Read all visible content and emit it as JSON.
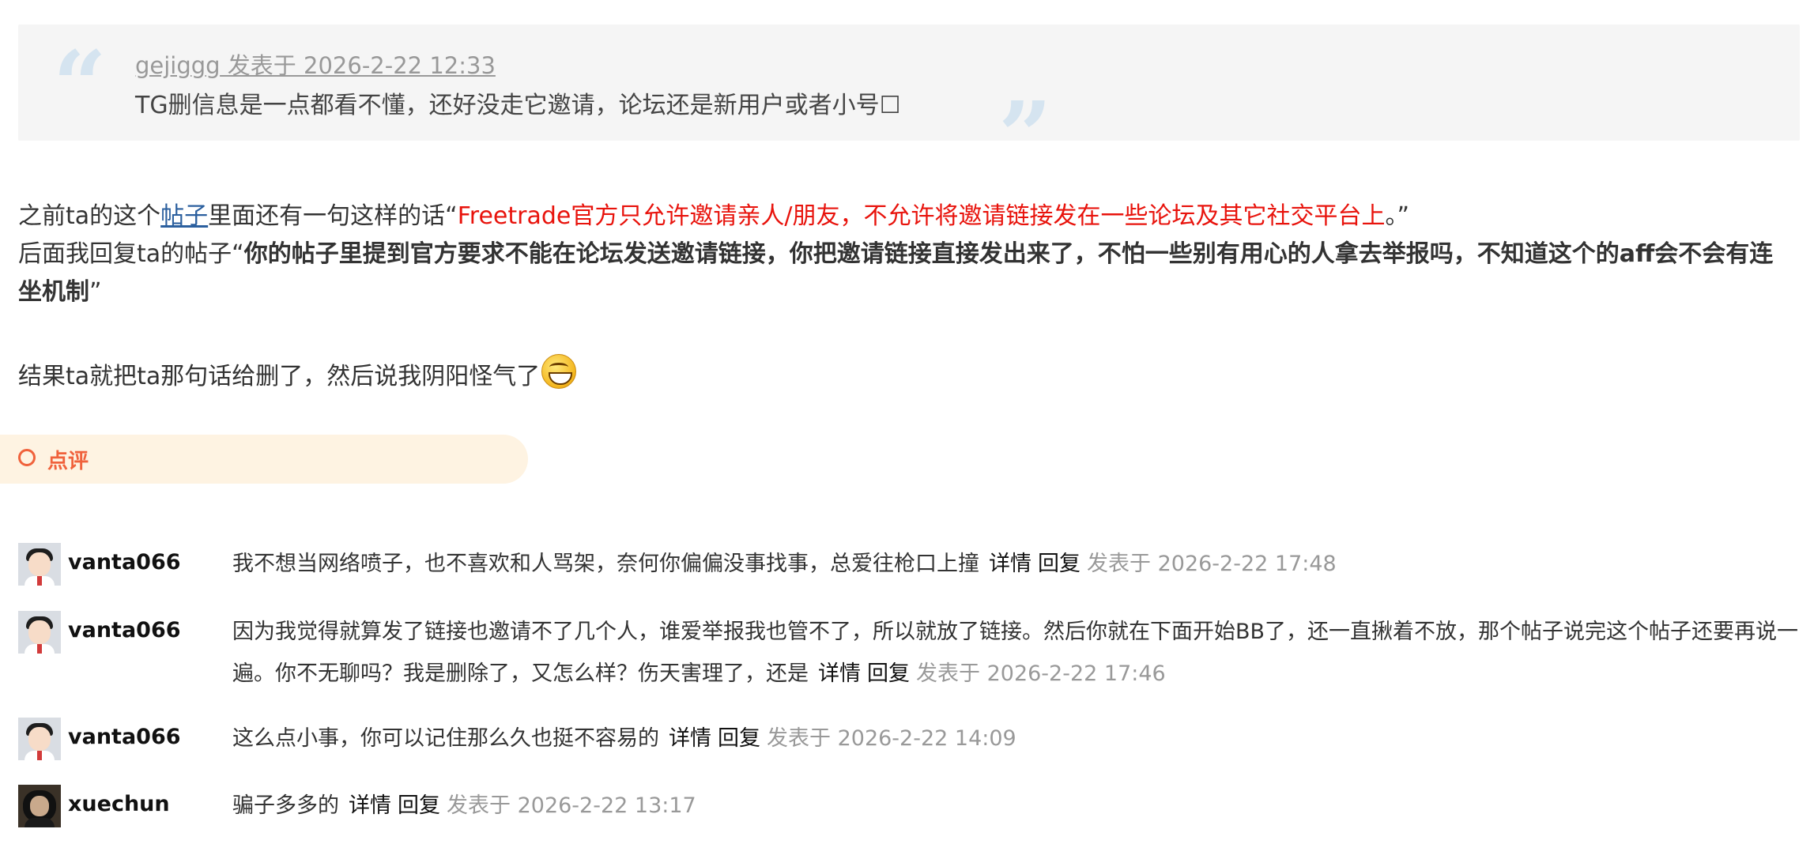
{
  "quote": {
    "author": "gejiggg",
    "meta_suffix": " 发表于 2026-2-22 12:33",
    "text": "TG删信息是一点都看不懂，还好没走它邀请，论坛还是新用户或者小号☐"
  },
  "post": {
    "line1_prefix": "之前ta的这个",
    "line1_link": "帖子",
    "line1_mid": "里面还有一句这样的话“",
    "line1_red": "Freetrade官方只允许邀请亲人/朋友，不允许将邀请链接发在一些论坛及其它社交平台上",
    "line1_suffix": "。”",
    "line2_prefix": "后面我回复ta的帖子“",
    "line2_bold": "你的帖子里提到官方要求不能在论坛发送邀请链接，你把邀请链接直接发出来了，不怕一些别有用心的人拿去举报吗，不知道这个的aff会不会有连坐机制",
    "line2_suffix": "”",
    "line4": "结果ta就把ta那句话给删了，然后说我阴阳怪气了"
  },
  "review": {
    "label": "点评"
  },
  "comments": [
    {
      "user": "vanta066",
      "text": "我不想当网络喷子，也不喜欢和人骂架，奈何你偏偏没事找事，总爱往枪口上撞",
      "detail": "详情",
      "reply": "回复",
      "time": "发表于 2026-2-22 17:48"
    },
    {
      "user": "vanta066",
      "text": "因为我觉得就算发了链接也邀请不了几个人，谁爱举报我也管不了，所以就放了链接。然后你就在下面开始BB了，还一直揪着不放，那个帖子说完这个帖子还要再说一遍。你不无聊吗？我是删除了，又怎么样？伤天害理了，还是",
      "detail": "详情",
      "reply": "回复",
      "time": "发表于 2026-2-22 17:46"
    },
    {
      "user": "vanta066",
      "text": "这么点小事，你可以记住那么久也挺不容易的",
      "detail": "详情",
      "reply": "回复",
      "time": "发表于 2026-2-22 14:09"
    },
    {
      "user": "xuechun",
      "text": "骗子多多的",
      "detail": "详情",
      "reply": "回复",
      "time": "发表于 2026-2-22 13:17"
    }
  ]
}
